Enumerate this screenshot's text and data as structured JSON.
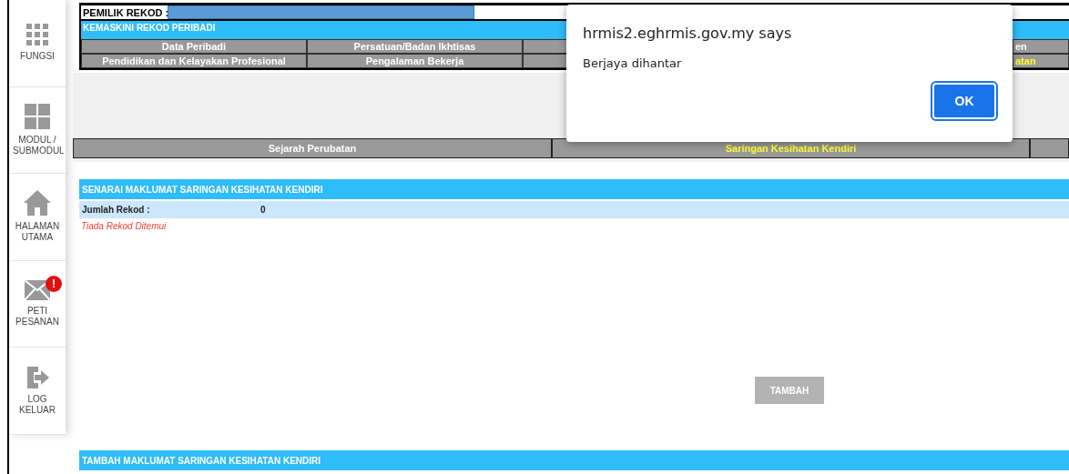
{
  "sidebar": {
    "items": [
      {
        "kind": "grid9",
        "label": "FUNGSI",
        "badge": false
      },
      {
        "kind": "grid4",
        "label": "MODUL / SUBMODUL",
        "badge": false
      },
      {
        "kind": "home",
        "label": "HALAMAN UTAMA",
        "badge": false
      },
      {
        "kind": "mail",
        "label": "PETI PESANAN",
        "badge": true,
        "badge_text": "!"
      },
      {
        "kind": "logout",
        "label": "LOG KELUAR",
        "badge": false
      }
    ]
  },
  "record_owner": {
    "label": "PEMILIK REKOD :"
  },
  "section_title": "KEMASKINI REKOD PERIBADI",
  "menu_rows": [
    [
      {
        "label": "Data Peribadi",
        "selected": false
      },
      {
        "label": "Persatuan/Badan Ikhtisas",
        "selected": false
      },
      {
        "label": "en",
        "selected": false
      }
    ],
    [
      {
        "label": "Pendidikan dan Kelayakan Profesional",
        "selected": false
      },
      {
        "label": "Pengalaman Bekerja",
        "selected": false
      },
      {
        "label": "atan",
        "selected": true
      }
    ]
  ],
  "sub_tabs": [
    {
      "label": "Sejarah Perubatan",
      "selected": false
    },
    {
      "label": "Saringan Kesihatan Kendiri",
      "selected": true
    }
  ],
  "list": {
    "title": "SENARAI MAKLUMAT SARINGAN KESIHATAN KENDIRI",
    "count_label": "Jumlah Rekod :",
    "count": "0",
    "empty_message": "Tiada Rekod Ditemui"
  },
  "add_button": "TAMBAH",
  "add_section_title": "TAMBAH MAKLUMAT SARINGAN KESIHATAN KENDIRI",
  "dialog": {
    "title": "hrmis2.eghrmis.gov.my says",
    "message": "Berjaya dihantar",
    "button": "OK"
  }
}
